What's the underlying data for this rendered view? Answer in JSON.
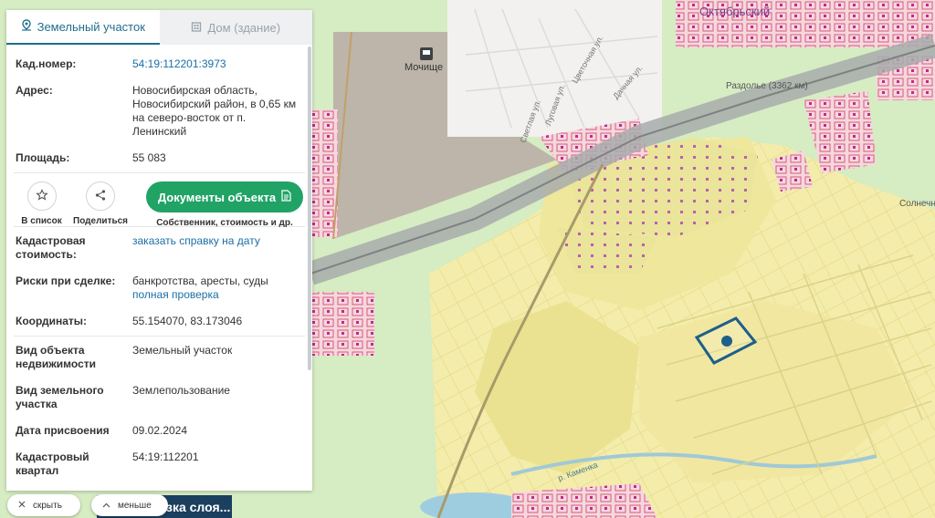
{
  "map": {
    "places": {
      "mochishche": "Мочище",
      "oktyabrsky": "Октябрьский",
      "razdolye": "Раздолье (3362 км)",
      "solnechnaya": "Солнечна",
      "river": "р. Каменка",
      "streets": [
        "Цветочная ул.",
        "Луговая ул.",
        "Дачная ул.",
        "Светлая ул."
      ]
    },
    "colors": {
      "forest": "#d6ecc2",
      "field": "#f4ecaa",
      "parcel_outline": "#1d5f8a",
      "built": "#e98aa0",
      "railway": "#a8acab"
    }
  },
  "panel": {
    "tabs": [
      {
        "label": "Земельный участок",
        "icon": "land-plot-icon",
        "active": true
      },
      {
        "label": "Дом (здание)",
        "icon": "building-icon",
        "active": false
      }
    ],
    "fields": {
      "cadastral_number": {
        "label": "Кад.номер:",
        "value": "54:19:112201:3973"
      },
      "address": {
        "label": "Адрес:",
        "value": [
          "Новосибирская область,",
          "Новосибирский район, в 0,65 км",
          "на северо-восток от п.",
          "Ленинский"
        ]
      },
      "area": {
        "label": "Площадь:",
        "value": "55 083"
      },
      "cadastral_value": {
        "label": [
          "Кадастровая",
          "стоимость:"
        ],
        "value": "заказать справку на дату"
      },
      "risks": {
        "label": "Риски при сделке:",
        "value": "банкротства, аресты, суды",
        "link": "полная проверка"
      },
      "coordinates": {
        "label": "Координаты:",
        "value": "55.154070, 83.173046"
      },
      "object_type": {
        "label": [
          "Вид объекта",
          "недвижимости"
        ],
        "value": "Земельный участок"
      },
      "land_type": {
        "label": [
          "Вид земельного",
          "участка"
        ],
        "value": "Землепользование"
      },
      "assign_date": {
        "label": "Дата присвоения",
        "value": "09.02.2024"
      },
      "quarter": {
        "label": [
          "Кадастровый",
          "квартал"
        ],
        "value": "54:19:112201"
      }
    },
    "actions": {
      "add_to_list": "В список",
      "share": "Поделиться",
      "documents": "Документы объекта",
      "documents_sub": "Собственник, стоимость и др."
    }
  },
  "bottom": {
    "hide": "скрыть",
    "less": "меньше",
    "layer_button": "зка слоя..."
  }
}
